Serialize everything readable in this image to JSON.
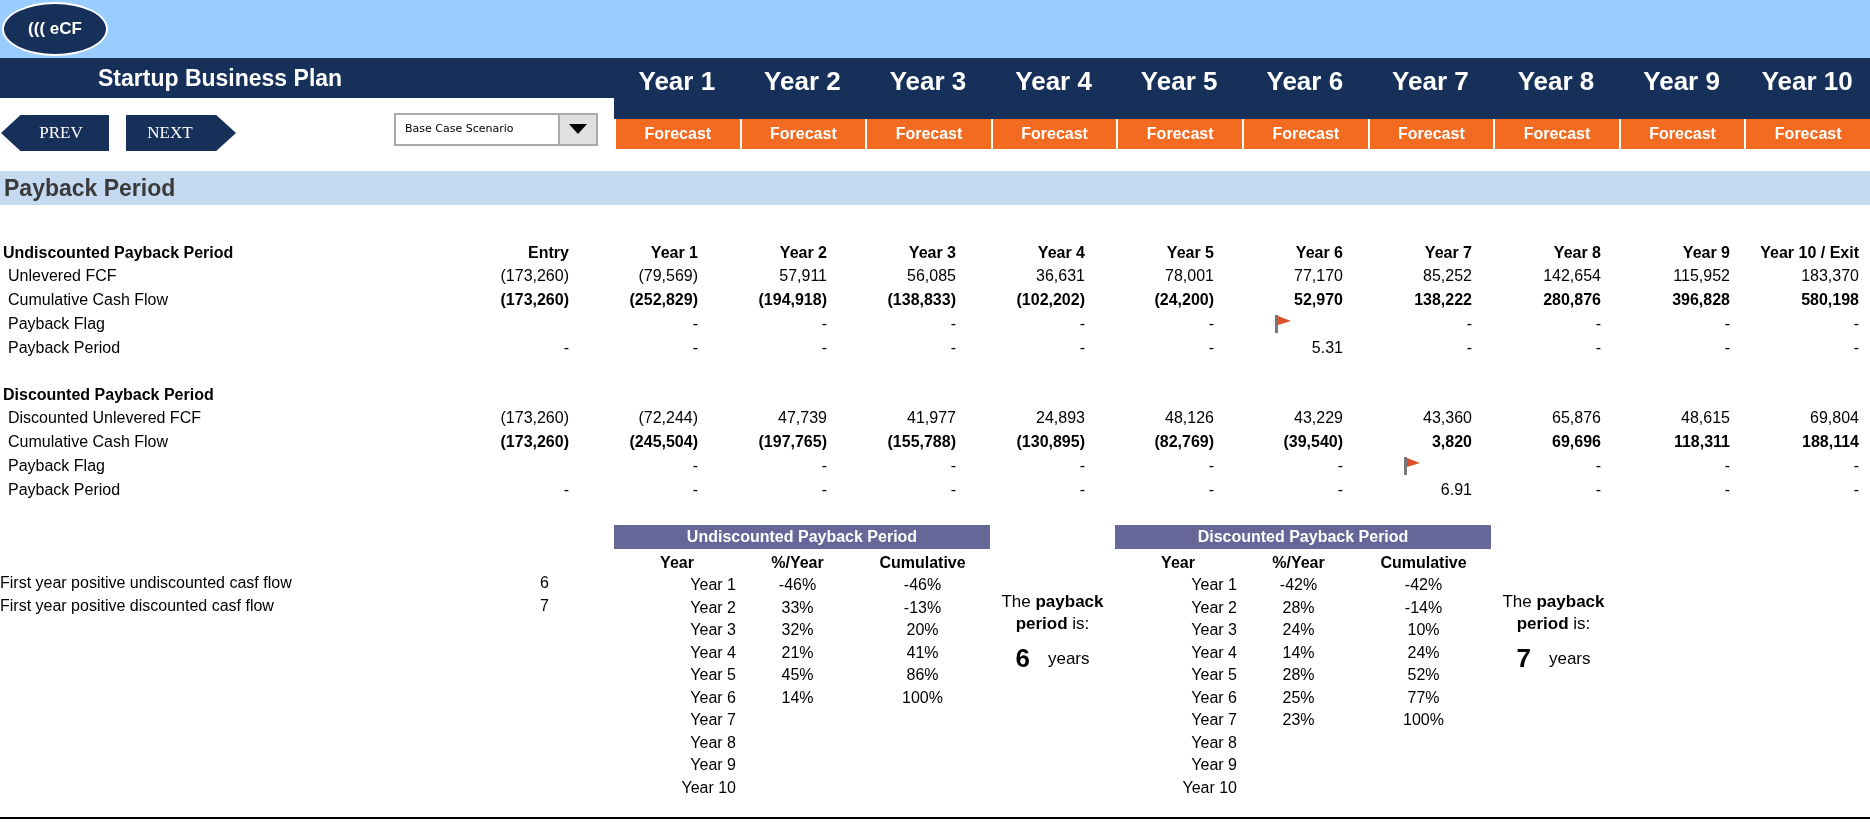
{
  "header": {
    "logo": "((( eCF",
    "title": "Startup Business Plan",
    "prev": "PREV",
    "next": "NEXT",
    "scenario": "Base Case Scenario",
    "years": [
      {
        "label": "Year 1",
        "status": "Forecast"
      },
      {
        "label": "Year 2",
        "status": "Forecast"
      },
      {
        "label": "Year 3",
        "status": "Forecast"
      },
      {
        "label": "Year 4",
        "status": "Forecast"
      },
      {
        "label": "Year 5",
        "status": "Forecast"
      },
      {
        "label": "Year 6",
        "status": "Forecast"
      },
      {
        "label": "Year 7",
        "status": "Forecast"
      },
      {
        "label": "Year 8",
        "status": "Forecast"
      },
      {
        "label": "Year 9",
        "status": "Forecast"
      },
      {
        "label": "Year 10",
        "status": "Forecast"
      }
    ]
  },
  "section_title": "Payback Period",
  "sections": [
    {
      "title": "Undiscounted Payback Period",
      "columns": [
        "Entry",
        "Year 1",
        "Year 2",
        "Year 3",
        "Year 4",
        "Year 5",
        "Year 6",
        "Year 7",
        "Year 8",
        "Year 9",
        "Year 10 / Exit"
      ],
      "rows": [
        {
          "label": "Unlevered FCF",
          "kind": "values",
          "bold": false,
          "cells": [
            "(173,260)",
            "(79,569)",
            "57,911",
            "56,085",
            "36,631",
            "78,001",
            "77,170",
            "85,252",
            "142,654",
            "115,952",
            "183,370"
          ]
        },
        {
          "label": "Cumulative Cash Flow",
          "kind": "values",
          "bold": true,
          "cells": [
            "(173,260)",
            "(252,829)",
            "(194,918)",
            "(138,833)",
            "(102,202)",
            "(24,200)",
            "52,970",
            "138,222",
            "280,876",
            "396,828",
            "580,198"
          ]
        },
        {
          "label": "Payback Flag",
          "kind": "flags",
          "bold": false,
          "cells": [
            null,
            {
              "flag": false,
              "text": "-"
            },
            {
              "flag": false,
              "text": "-"
            },
            {
              "flag": false,
              "text": "-"
            },
            {
              "flag": false,
              "text": "-"
            },
            {
              "flag": false,
              "text": "-"
            },
            {
              "flag": true
            },
            {
              "flag": false,
              "text": "-"
            },
            {
              "flag": false,
              "text": "-"
            },
            {
              "flag": false,
              "text": "-"
            },
            {
              "flag": false,
              "text": "-"
            }
          ]
        },
        {
          "label": "Payback Period",
          "kind": "values",
          "bold": false,
          "cells": [
            "-",
            "-",
            "-",
            "-",
            "-",
            "-",
            "5.31",
            "-",
            "-",
            "-",
            "-"
          ]
        }
      ]
    },
    {
      "title": "Discounted Payback Period",
      "rows": [
        {
          "label": "Discounted Unlevered FCF",
          "kind": "values",
          "bold": false,
          "cells": [
            "(173,260)",
            "(72,244)",
            "47,739",
            "41,977",
            "24,893",
            "48,126",
            "43,229",
            "43,360",
            "65,876",
            "48,615",
            "69,804"
          ]
        },
        {
          "label": "Cumulative Cash Flow",
          "kind": "values",
          "bold": true,
          "cells": [
            "(173,260)",
            "(245,504)",
            "(197,765)",
            "(155,788)",
            "(130,895)",
            "(82,769)",
            "(39,540)",
            "3,820",
            "69,696",
            "118,311",
            "188,114"
          ]
        },
        {
          "label": "Payback Flag",
          "kind": "flags",
          "bold": false,
          "cells": [
            null,
            {
              "flag": false,
              "text": "-"
            },
            {
              "flag": false,
              "text": "-"
            },
            {
              "flag": false,
              "text": "-"
            },
            {
              "flag": false,
              "text": "-"
            },
            {
              "flag": false,
              "text": "-"
            },
            {
              "flag": false,
              "text": "-"
            },
            {
              "flag": true
            },
            {
              "flag": false,
              "text": "-"
            },
            {
              "flag": false,
              "text": "-"
            },
            {
              "flag": false,
              "text": "-"
            }
          ]
        },
        {
          "label": "Payback Period",
          "kind": "values",
          "bold": false,
          "cells": [
            "-",
            "-",
            "-",
            "-",
            "-",
            "-",
            "-",
            "6.91",
            "-",
            "-",
            "-"
          ]
        }
      ]
    }
  ],
  "facts": [
    {
      "label": "First year positive undiscounted casf flow",
      "value": "6"
    },
    {
      "label": "First year positive discounted casf flow",
      "value": "7"
    }
  ],
  "summaries": [
    {
      "title": "Undiscounted Payback Period",
      "columns": [
        "Year",
        "%/Year",
        "Cumulative"
      ],
      "rows": [
        {
          "year": "Year 1",
          "pct": "-46%",
          "cum": "-46%"
        },
        {
          "year": "Year 2",
          "pct": "33%",
          "cum": "-13%"
        },
        {
          "year": "Year 3",
          "pct": "32%",
          "cum": "20%"
        },
        {
          "year": "Year 4",
          "pct": "21%",
          "cum": "41%"
        },
        {
          "year": "Year 5",
          "pct": "45%",
          "cum": "86%"
        },
        {
          "year": "Year 6",
          "pct": "14%",
          "cum": "100%"
        },
        {
          "year": "Year 7"
        },
        {
          "year": "Year 8"
        },
        {
          "year": "Year 9"
        },
        {
          "year": "Year 10"
        }
      ],
      "result": {
        "text": "The **payback period** is:",
        "value": "6",
        "unit": "years"
      }
    },
    {
      "title": "Discounted Payback Period",
      "columns": [
        "Year",
        "%/Year",
        "Cumulative"
      ],
      "rows": [
        {
          "year": "Year 1",
          "pct": "-42%",
          "cum": "-42%"
        },
        {
          "year": "Year 2",
          "pct": "28%",
          "cum": "-14%"
        },
        {
          "year": "Year 3",
          "pct": "24%",
          "cum": "10%"
        },
        {
          "year": "Year 4",
          "pct": "14%",
          "cum": "24%"
        },
        {
          "year": "Year 5",
          "pct": "28%",
          "cum": "52%"
        },
        {
          "year": "Year 6",
          "pct": "25%",
          "cum": "77%"
        },
        {
          "year": "Year 7",
          "pct": "23%",
          "cum": "100%"
        },
        {
          "year": "Year 8"
        },
        {
          "year": "Year 9"
        },
        {
          "year": "Year 10"
        }
      ],
      "result": {
        "text": "The **payback period** is:",
        "value": "7",
        "unit": "years"
      }
    }
  ]
}
